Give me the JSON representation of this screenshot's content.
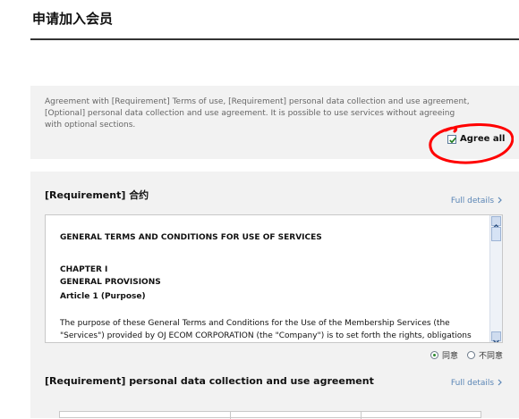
{
  "page": {
    "title": "申请加入会员"
  },
  "agreement": {
    "text": "Agreement with [Requirement] Terms of use, [Requirement] personal data collection and use agreement, [Optional] personal data collection and use agreement. It is possible to use services without agreeing with optional sections.",
    "agree_all_label": "Agree all",
    "agree_all_checked": true
  },
  "section_terms": {
    "title": "[Requirement] 合约",
    "full_details": "Full details",
    "heading": "GENERAL TERMS AND CONDITIONS FOR USE OF SERVICES",
    "chapter": "CHAPTER I",
    "chapter_title": "GENERAL PROVISIONS",
    "article": "Article 1 (Purpose)",
    "paragraph": "The purpose of these General Terms and Conditions for the Use of the Membership Services (the \"Services\") provided by OJ ECOM CORPORATION (the \"Company\") is to set forth the rights, obligations",
    "radio_agree": "同意",
    "radio_disagree": "不同意",
    "selected": "同意"
  },
  "section_personal": {
    "title": "[Requirement] personal data collection and use agreement",
    "full_details": "Full details"
  },
  "icons": {
    "checkbox": "checkmark-icon",
    "chevron": "chevron-right-icon",
    "scroll_up": "scroll-up-arrow-icon",
    "scroll_down": "scroll-down-arrow-icon"
  },
  "colors": {
    "link": "#5b86b6",
    "annotation": "#ff0000",
    "panel": "#f2f2f2"
  }
}
